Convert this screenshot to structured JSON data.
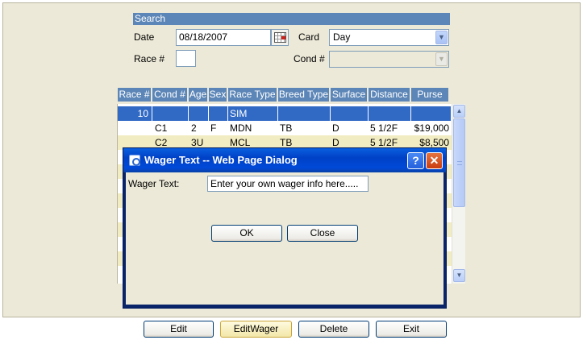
{
  "search": {
    "header": "Search",
    "date_label": "Date",
    "date_value": "08/18/2007",
    "card_label": "Card",
    "card_value": "Day",
    "race_label": "Race #",
    "race_value": "",
    "cond_label": "Cond #",
    "cond_value": ""
  },
  "table": {
    "columns": [
      "Race #",
      "Cond #",
      "Age",
      "Sex",
      "Race Type",
      "Breed Type",
      "Surface",
      "Distance",
      "Purse"
    ],
    "rows": [
      {
        "race": "10",
        "cond": "",
        "age": "",
        "sex": "",
        "type": "SIM",
        "breed": "",
        "surface": "",
        "distance": "",
        "purse": ""
      },
      {
        "race": "",
        "cond": "C1",
        "age": "2",
        "sex": "F",
        "type": "MDN",
        "breed": "TB",
        "surface": "D",
        "distance": "5 1/2F",
        "purse": "$19,000"
      },
      {
        "race": "",
        "cond": "C2",
        "age": "3U",
        "sex": "",
        "type": "MCL",
        "breed": "TB",
        "surface": "D",
        "distance": "5 1/2F",
        "purse": "$8,500"
      }
    ]
  },
  "buttons": {
    "edit": "Edit",
    "edit_wager": "EditWager",
    "delete": "Delete",
    "exit": "Exit"
  },
  "dialog": {
    "title": "Wager Text -- Web Page Dialog",
    "field_label": "Wager Text:",
    "field_value": "Enter your own wager info here.....",
    "ok": "OK",
    "close": "Close",
    "help_glyph": "?",
    "close_glyph": "✕"
  },
  "colors": {
    "header_blue": "#5c86b7",
    "selection_blue": "#316ac5",
    "alt_row": "#f2ecc2",
    "panel_bg": "#ece9d8",
    "dialog_title": "#0041c6"
  }
}
